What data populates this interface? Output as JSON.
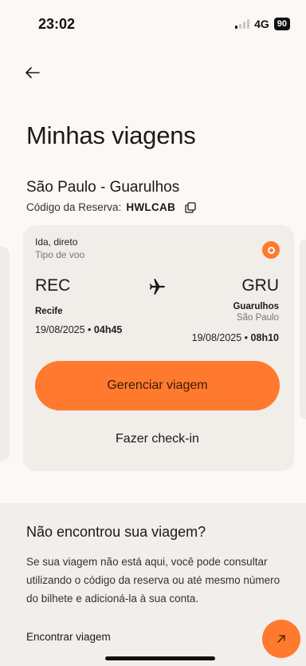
{
  "status": {
    "time": "23:02",
    "network": "4G",
    "battery": "90"
  },
  "header": {
    "back_icon": "arrow-left-icon",
    "title": "Minhas viagens"
  },
  "booking": {
    "route": "São Paulo - Guarulhos",
    "code_label": "Código da Reserva:",
    "code": "HWLCAB",
    "copy_icon": "copy-icon"
  },
  "trip": {
    "trip_type": "Ida, direto",
    "flight_type_label": "Tipo de voo",
    "airline_icon": "airline-logo-icon",
    "origin": {
      "code": "REC",
      "city": "Recife",
      "date": "19/08/2025",
      "time": "04h45"
    },
    "destination": {
      "code": "GRU",
      "city": "Guarulhos",
      "state": "São Paulo",
      "date": "19/08/2025",
      "time": "08h10"
    },
    "separator": "•",
    "manage_label": "Gerenciar viagem",
    "checkin_label": "Fazer check-in"
  },
  "not_found": {
    "title": "Não encontrou sua viagem?",
    "text": "Se sua viagem não está aqui, você pode consultar utilizando o código da reserva ou até mesmo número do bilhete e adicioná-la à sua conta.",
    "link_label": "Encontrar viagem",
    "fab_icon": "arrow-up-right-icon"
  },
  "colors": {
    "accent": "#ff7a2e",
    "background": "#fbf8f5",
    "card": "#f1ede9"
  }
}
